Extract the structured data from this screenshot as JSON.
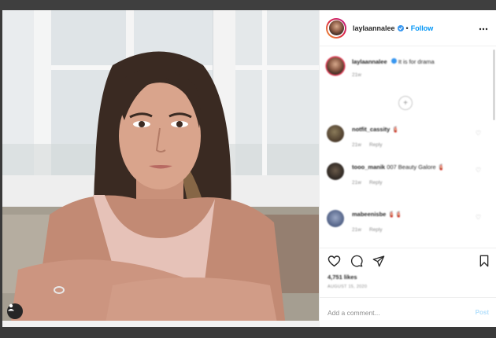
{
  "post": {
    "username": "laylaannalee",
    "separator": "•",
    "follow_label": "Follow",
    "more_icon": "more-icon",
    "verified_color": "#3897f0",
    "accent_color": "#0095f6"
  },
  "caption": {
    "username": "laylaannalee",
    "text": "It is for drama",
    "time": "21w"
  },
  "comments": [
    {
      "username": "notfit_cassity",
      "text": "🧯",
      "time": "21w",
      "reply_label": "Reply"
    },
    {
      "username": "tooo_manik",
      "text": "007 Beauty Galore 🧯",
      "time": "21w",
      "reply_label": "Reply"
    },
    {
      "username": "mabeenisbe",
      "text": "🧯🧯",
      "time": "21w",
      "reply_label": "Reply"
    }
  ],
  "actions": {
    "likes": "4,751 likes",
    "date": "AUGUST 15, 2020",
    "comment_placeholder": "Add a comment...",
    "post_label": "Post"
  }
}
